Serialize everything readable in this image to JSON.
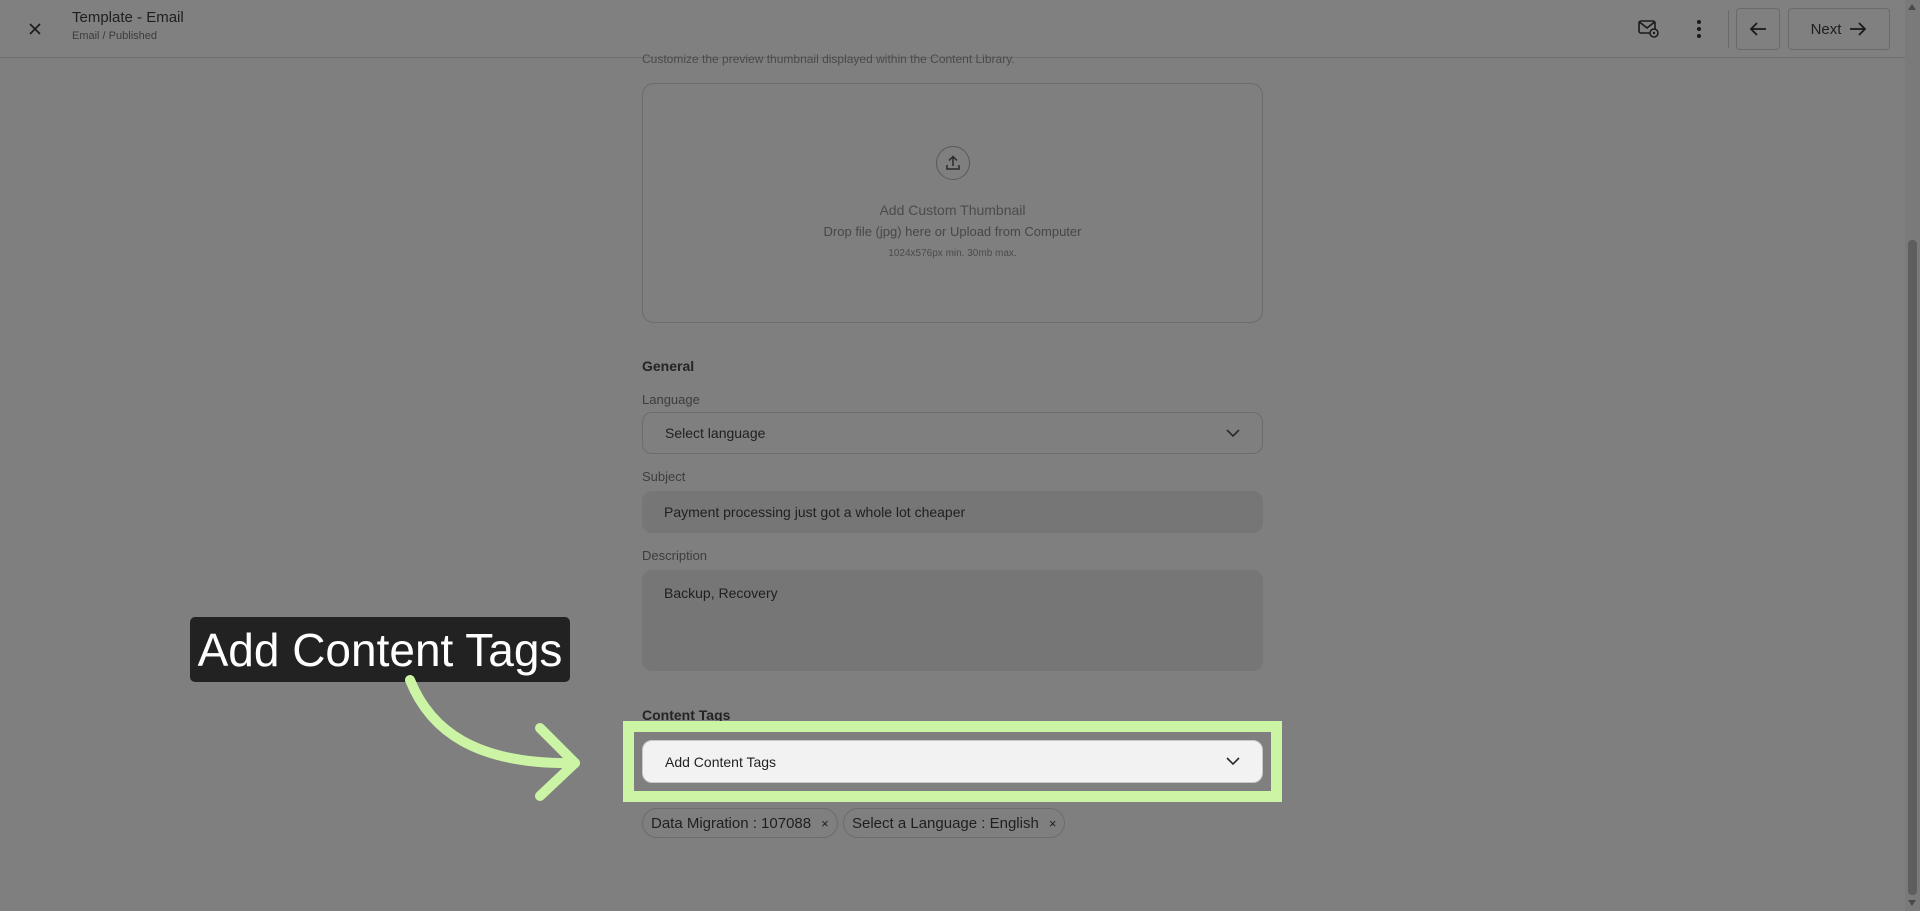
{
  "header": {
    "title": "Template - Email",
    "breadcrumb": "Email / Published",
    "next_label": "Next"
  },
  "thumbnail": {
    "helper_text": "Customize the preview thumbnail displayed within the Content Library.",
    "title": "Add Custom Thumbnail",
    "subtitle": "Drop file (jpg) here or Upload from Computer",
    "limits": "1024x576px min. 30mb max."
  },
  "general": {
    "section_title": "General",
    "language_label": "Language",
    "language_value": "Select language",
    "subject_label": "Subject",
    "subject_value": "Payment processing just got a whole lot cheaper",
    "description_label": "Description",
    "description_value": "Backup, Recovery"
  },
  "content_tags": {
    "section_title": "Content Tags",
    "placeholder": "Add Content Tags",
    "chips": [
      {
        "label": "Data Migration : 107088",
        "remove": "×"
      },
      {
        "label": "Select a Language : English",
        "remove": "×"
      }
    ]
  },
  "callout": {
    "text": "Add Content Tags"
  },
  "colors": {
    "highlight": "#cbf5a4",
    "overlay": "#7f7f7f",
    "callout_bg": "#222222"
  }
}
